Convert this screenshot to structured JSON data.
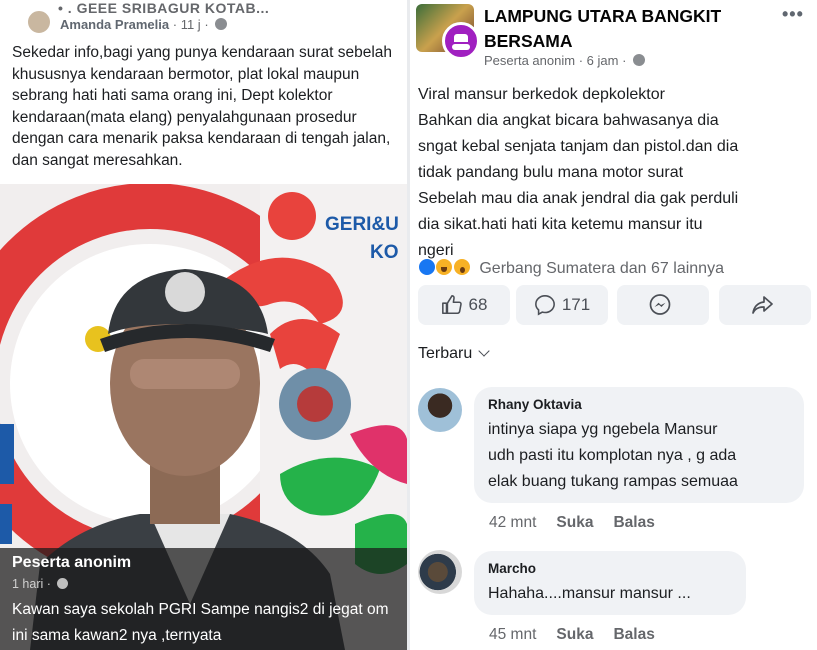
{
  "left_post": {
    "header_topline": "• .  GEEE  SRIBAGUR  KOTAB...",
    "author": "Amanda Pramelia",
    "time": "11 j",
    "body": "Sekedar info,bagi yang punya kendaraan surat sebelah khususnya kendaraan bermotor, plat lokal maupun sebrang hati hati sama orang ini, Dept kolektor kendaraan(mata elang) penyalahgunaan prosedur dengan cara menarik paksa kendaraan di tengah jalan, dan sangat meresahkan.",
    "overlay": {
      "author": "Peserta anonim",
      "time": "1 hari",
      "body": "Kawan saya sekolah PGRI Sampe nangis2 di jegat om ini sama kawan2 nya ,ternyata"
    },
    "photo_sign_text": "GERI&U",
    "photo_sign_text2": "KO"
  },
  "right_post": {
    "group_title": "LAMPUNG UTARA BANGKIT BERSAMA",
    "author": "Peserta anonim",
    "time": "6 jam",
    "more": "•••",
    "body_lines": [
      "Viral mansur berkedok depkolektor",
      "Bahkan dia angkat bicara bahwasanya dia",
      "sngat kebal senjata tanjam dan pistol.dan dia",
      "tidak pandang bulu mana motor surat",
      "Sebelah mau dia anak jendral dia gak perduli",
      "dia sikat.hati hati kita ketemu mansur itu",
      "ngeri"
    ],
    "reactions_text": "Gerbang Sumatera dan 67 lainnya",
    "actions": {
      "like_count": "68",
      "comment_count": "171"
    },
    "sort_label": "Terbaru",
    "comments": [
      {
        "name": "Rhany Oktavia",
        "lines": [
          "intinya siapa yg ngebela Mansur",
          "udh pasti itu komplotan nya , g ada",
          "elak buang tukang rampas semuaa"
        ],
        "time": "42 mnt",
        "like": "Suka",
        "reply": "Balas"
      },
      {
        "name": "Marcho",
        "lines": [
          "Hahaha....mansur mansur ..."
        ],
        "time": "45 mnt",
        "like": "Suka",
        "reply": "Balas"
      }
    ]
  },
  "colors": {
    "facebook_blue": "#1877f2",
    "text": "#1c1e21",
    "muted": "#65676b",
    "bubble": "#f0f2f5"
  }
}
